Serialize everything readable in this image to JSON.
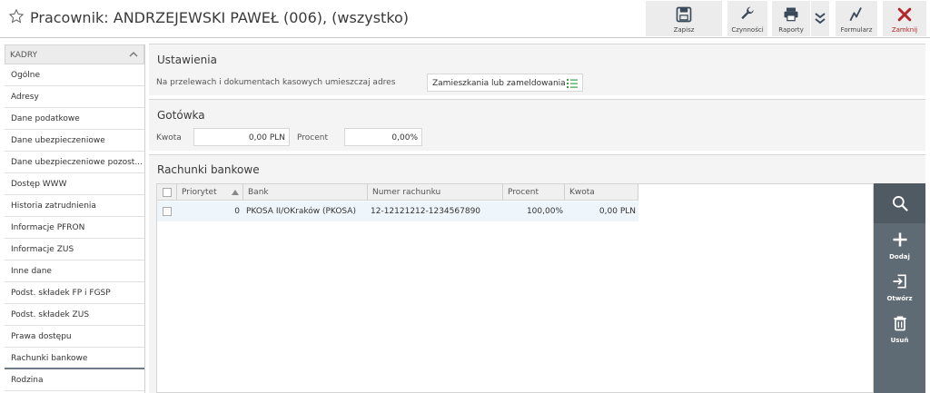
{
  "header": {
    "title": "Pracownik: ANDRZEJEWSKI PAWEŁ (006), (wszystko)"
  },
  "toolbar": {
    "save": "Zapisz",
    "actions": "Czynności",
    "reports": "Raporty",
    "forms": "Formularz",
    "close": "Zamknij"
  },
  "sidebar": {
    "section": "KADRY",
    "items": [
      "Ogólne",
      "Adresy",
      "Dane podatkowe",
      "Dane ubezpieczeniowe",
      "Dane ubezpieczeniowe pozost...",
      "Dostęp WWW",
      "Historia zatrudnienia",
      "Informacje PFRON",
      "Informacje ZUS",
      "Inne dane",
      "Podst. składek FP i FGŚP",
      "Podst. składek ZUS",
      "Prawa dostępu",
      "Rachunki bankowe",
      "Rodzina"
    ]
  },
  "settings": {
    "title": "Ustawienia",
    "address_label": "Na przelewach i dokumentach kasowych umieszczaj adres",
    "address_value": "Zamieszkania lub zameldowania"
  },
  "cash": {
    "title": "Gotówka",
    "amount_label": "Kwota",
    "amount_value": "0,00 PLN",
    "percent_label": "Procent",
    "percent_value": "0,00%"
  },
  "accounts": {
    "title": "Rachunki bankowe",
    "columns": [
      "Priorytet",
      "Bank",
      "Numer rachunku",
      "Procent",
      "Kwota"
    ],
    "rows": [
      {
        "priority": "0",
        "bank": "PKOSA II/OKraków (PKOSA)",
        "number": "12-12121212-1234567890",
        "percent": "100,00%",
        "amount": "0,00 PLN"
      }
    ]
  },
  "grid_actions": {
    "add": "Dodaj",
    "open": "Otwórz",
    "delete": "Usuń"
  },
  "colors": {
    "close_red": "#b3262a",
    "action_bar": "#5f6b74",
    "selected_row": "#eef5fb"
  }
}
